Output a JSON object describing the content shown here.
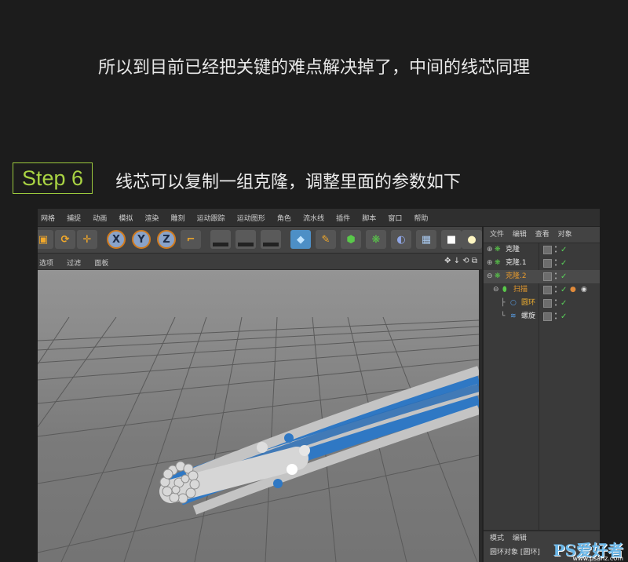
{
  "intro_text": "所以到目前已经把关键的难点解决掉了，中间的线芯同理",
  "step": {
    "badge": "Step 6",
    "text": "线芯可以复制一组克隆，调整里面的参数如下"
  },
  "menubar": [
    "网格",
    "捕捉",
    "动画",
    "模拟",
    "渲染",
    "雕刻",
    "运动跟踪",
    "运动图形",
    "角色",
    "流水线",
    "插件",
    "脚本",
    "窗口",
    "帮助"
  ],
  "axis_buttons": [
    "X",
    "Y",
    "Z"
  ],
  "viewbar": {
    "items": [
      "选项",
      "过滤",
      "面板"
    ],
    "icons": "✥ ↓ ⟲ ⧉"
  },
  "object_manager": {
    "tabs": [
      "文件",
      "编辑",
      "查看",
      "对象"
    ],
    "objects": [
      {
        "name": "克隆",
        "color": "#d8d8d8"
      },
      {
        "name": "克隆.1",
        "color": "#d8d8d8"
      },
      {
        "name": "克隆.2",
        "color": "#e79a2d"
      },
      {
        "name": "扫描",
        "color": "#e79a2d"
      },
      {
        "name": "圆环",
        "color": "#f0b030"
      },
      {
        "name": "螺旋",
        "color": "#d8d8d8"
      }
    ]
  },
  "attributes": {
    "tabs": [
      "模式",
      "编辑"
    ],
    "object_label": "圆环对象 [圆环]"
  },
  "watermark": {
    "logo": "PS爱好者",
    "url": "www.psahz.com"
  },
  "colors": {
    "accent_green": "#a9d343",
    "rope_blue": "#2f78c4",
    "rope_gray": "#c4c4c4"
  }
}
